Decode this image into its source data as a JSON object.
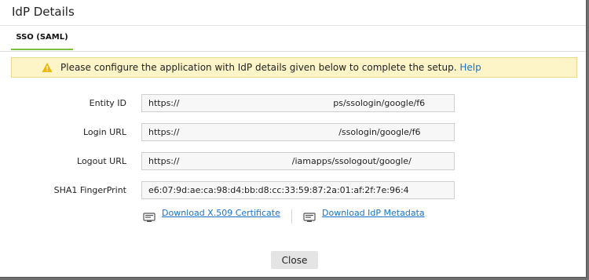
{
  "dialog": {
    "title": "IdP Details"
  },
  "tabs": [
    {
      "label": "SSO (SAML)",
      "active": true
    }
  ],
  "banner": {
    "icon": "warning-icon",
    "message": "Please configure the application with IdP details given below to complete the setup.",
    "help_label": "Help"
  },
  "fields": [
    {
      "label": "Entity ID",
      "value": "https://                                                        ps/ssologin/google/f6"
    },
    {
      "label": "Login URL",
      "value": "https://                                                          /ssologin/google/f6"
    },
    {
      "label": "Logout URL",
      "value": "https://                                         /iamapps/ssologout/google/"
    },
    {
      "label": "SHA1 FingerPrint",
      "value": "e6:07:9d:ae:ca:98:d4:bb:d8:cc:33:59:87:2a:01:af:2f:7e:96:4"
    }
  ],
  "downloads": {
    "certificate_label": "Download X.509 Certificate",
    "metadata_label": "Download IdP Metadata"
  },
  "footer": {
    "close_label": "Close"
  },
  "colors": {
    "accent": "#7cc043",
    "link": "#1a73c8",
    "banner_bg": "#fdf5c8"
  }
}
